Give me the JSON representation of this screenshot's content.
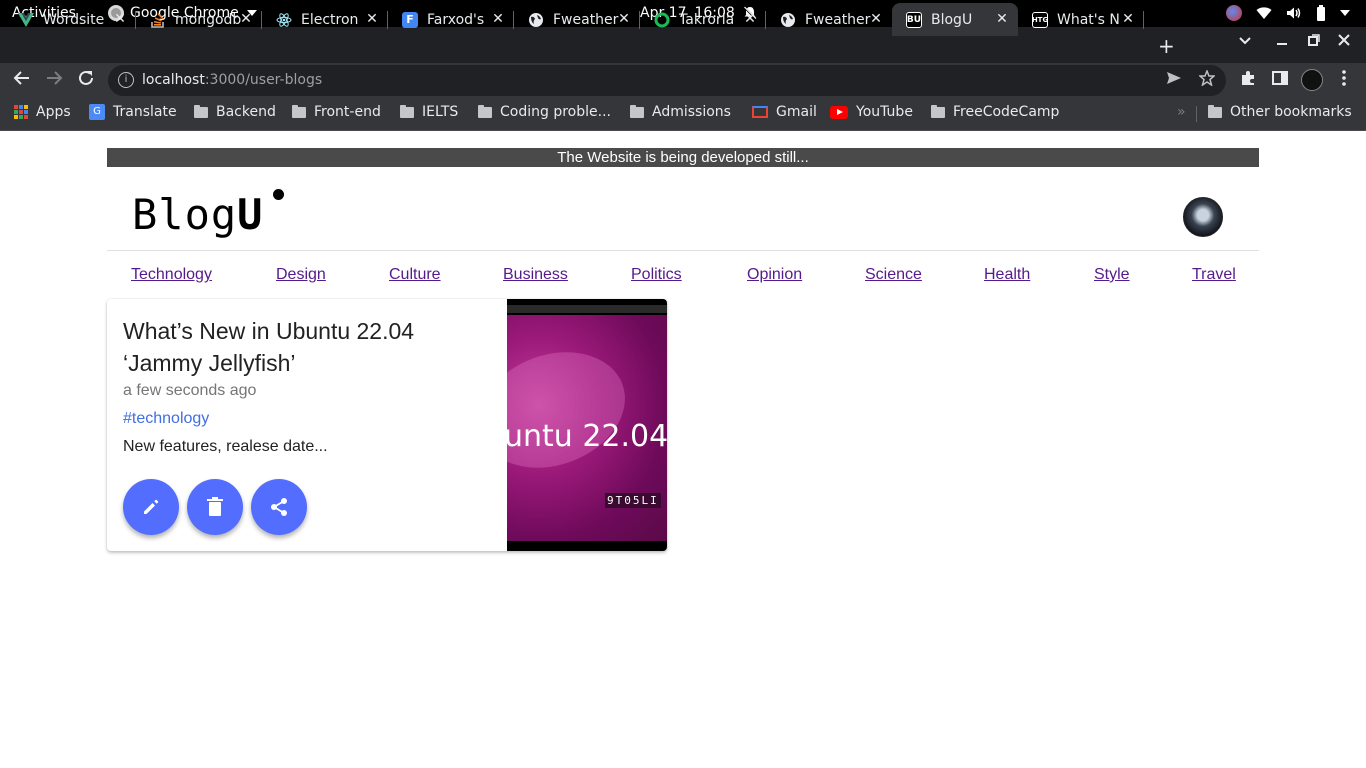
{
  "system_bar": {
    "activities": "Activities",
    "app_name": "Google Chrome",
    "date": "Apr 17",
    "time": "16:08"
  },
  "tabs": [
    {
      "title": "Wordsite",
      "icon": "vue-icon",
      "color": "#41b883"
    },
    {
      "title": "mongodb",
      "icon": "stackoverflow-icon",
      "color": "#f48024"
    },
    {
      "title": "Electron",
      "icon": "electron-icon",
      "color": "#9feaf9"
    },
    {
      "title": "Farxod's",
      "icon": "f-icon",
      "color": "#4285f4"
    },
    {
      "title": "Fweather",
      "icon": "globe-icon",
      "color": "#e8eaed"
    },
    {
      "title": "Takrorla",
      "icon": "ring-icon",
      "color": "#1db954"
    },
    {
      "title": "Fweather",
      "icon": "globe-icon",
      "color": "#e8eaed"
    },
    {
      "title": "BlogU",
      "icon": "bu-icon",
      "color": "#000000",
      "active": true
    },
    {
      "title": "What's N",
      "icon": "htg-icon",
      "color": "#000000"
    }
  ],
  "address_bar": {
    "host": "localhost",
    "path": ":3000/user-blogs"
  },
  "bookmarks": {
    "apps": "Apps",
    "translate": "Translate",
    "backend": "Backend",
    "frontend": "Front-end",
    "ielts": "IELTS",
    "coding": "Coding proble...",
    "admissions": "Admissions",
    "gmail": "Gmail",
    "youtube": "YouTube",
    "freecodecamp": "FreeCodeCamp",
    "other": "Other bookmarks",
    "overflow": "»"
  },
  "page": {
    "banner": "The Website is being developed still...",
    "logo_regular": "Blog",
    "logo_bold": "U",
    "categories": [
      "Technology",
      "Design",
      "Culture",
      "Business",
      "Politics",
      "Opinion",
      "Science",
      "Health",
      "Style",
      "Travel"
    ],
    "post": {
      "title": "What’s New in Ubuntu 22.04 ‘Jammy Jellyfish’",
      "time": "a few seconds ago",
      "tag": "#technology",
      "description": "New features, realese date...",
      "image_text": "untu 22.04",
      "image_small_text": "9T05LI"
    },
    "colors": {
      "fab": "#536dfe",
      "link": "#551a8b",
      "tag": "#3f6fe0",
      "banner": "#4a4a4a"
    }
  }
}
